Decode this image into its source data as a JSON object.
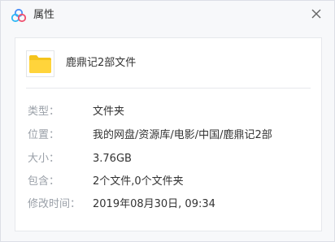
{
  "window": {
    "title": "属性",
    "app_icon": "cloud-logo-icon",
    "close_icon": "close-icon"
  },
  "file": {
    "name": "鹿鼎记2部文件",
    "icon": "folder-icon",
    "icon_color": "#f5c41d"
  },
  "properties": [
    {
      "label": "类型：",
      "value": "文件夹"
    },
    {
      "label": "位置：",
      "value": "我的网盘/资源库/电影/中国/鹿鼎记2部"
    },
    {
      "label": "大小：",
      "value": "3.76GB"
    },
    {
      "label": "包含：",
      "value": "2个文件,0个文件夹"
    },
    {
      "label": "修改时间：",
      "value": "2019年08月30日, 09:34"
    }
  ]
}
